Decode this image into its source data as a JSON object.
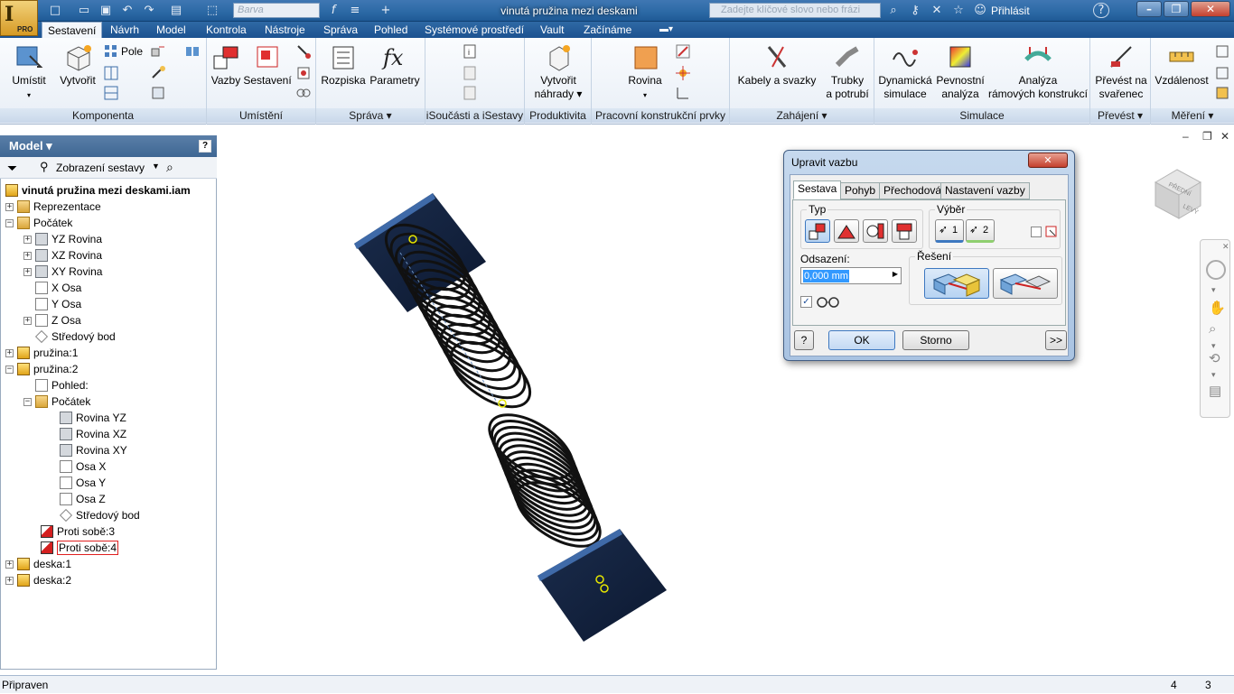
{
  "app": {
    "badge": "PRO",
    "window_title": "vinutá pružina mezi deskami"
  },
  "quick_access": {
    "color_placeholder": "Barva",
    "search_placeholder": "Zadejte klíčové slovo nebo frázi",
    "signin": "Přihlásit"
  },
  "tabs": [
    "Sestavení",
    "Návrh",
    "Model",
    "Kontrola",
    "Nástroje",
    "Správa",
    "Pohled",
    "Systémové prostředí",
    "Vault",
    "Začínáme"
  ],
  "ribbon": {
    "komponenta": {
      "title": "Komponenta",
      "umistit": "Umístit",
      "vytvorit": "Vytvořit",
      "pole": "Pole"
    },
    "umisteni": {
      "title": "Umístění",
      "vazby": "Vazby",
      "sestaveni": "Sestavení"
    },
    "sprava": {
      "title": "Správa",
      "rozpiska": "Rozpiska",
      "parametry": "Parametry"
    },
    "isoucasti": {
      "title": "iSoučásti a iSestavy"
    },
    "produktivita": {
      "title": "Produktivita",
      "vytvorit_nahrady_1": "Vytvořit",
      "vytvorit_nahrady_2": "náhrady"
    },
    "pracovni": {
      "title": "Pracovní konstrukční prvky",
      "rovina": "Rovina"
    },
    "zahajeni": {
      "title": "Zahájení",
      "kabely": "Kabely a svazky",
      "trubky_1": "Trubky",
      "trubky_2": "a potrubí"
    },
    "simulace": {
      "title": "Simulace",
      "dyn_1": "Dynamická",
      "dyn_2": "simulace",
      "pev_1": "Pevnostní",
      "pev_2": "analýza",
      "ram_1": "Analýza",
      "ram_2": "rámových konstrukcí"
    },
    "prevest": {
      "title": "Převést",
      "sv_1": "Převést na",
      "sv_2": "svařenec"
    },
    "mereni": {
      "title": "Měření",
      "vzdalenost": "Vzdálenost"
    }
  },
  "browser": {
    "header": "Model",
    "view": "Zobrazení sestavy",
    "items": [
      {
        "label": "vinutá pružina mezi deskami.iam"
      },
      {
        "label": "Reprezentace"
      },
      {
        "label": "Počátek"
      },
      {
        "label": "YZ Rovina"
      },
      {
        "label": "XZ Rovina"
      },
      {
        "label": "XY Rovina"
      },
      {
        "label": "X Osa"
      },
      {
        "label": "Y Osa"
      },
      {
        "label": "Z Osa"
      },
      {
        "label": "Středový bod"
      },
      {
        "label": "pružina:1"
      },
      {
        "label": "pružina:2"
      },
      {
        "label": "Pohled:"
      },
      {
        "label": "Počátek"
      },
      {
        "label": "Rovina YZ"
      },
      {
        "label": "Rovina XZ"
      },
      {
        "label": "Rovina XY"
      },
      {
        "label": "Osa X"
      },
      {
        "label": "Osa Y"
      },
      {
        "label": "Osa Z"
      },
      {
        "label": "Středový bod"
      },
      {
        "label": "Proti sobě:3"
      },
      {
        "label": "Proti sobě:4"
      },
      {
        "label": "deska:1"
      },
      {
        "label": "deska:2"
      }
    ]
  },
  "dialog": {
    "title": "Upravit vazbu",
    "tabs": [
      "Sestava",
      "Pohyb",
      "Přechodová",
      "Nastavení vazby"
    ],
    "typ": "Typ",
    "vyber": "Výběr",
    "sel1": "1",
    "sel2": "2",
    "odsazeni": "Odsazení:",
    "offset_value": "0,000 mm",
    "reseni": "Řešení",
    "ok": "OK",
    "storno": "Storno",
    "more": ">>"
  },
  "viewcube": {
    "top": "PŘEDNÍ",
    "side": "LEVÝ"
  },
  "status": {
    "text": "Připraven",
    "num1": "4",
    "num2": "3"
  },
  "colors": {
    "accent": "#1d5290",
    "plate": "#0f1f3a",
    "plate_edge": "#3f6aa8",
    "spring": "#1a1a1a",
    "selected_outline": "#e02020"
  }
}
